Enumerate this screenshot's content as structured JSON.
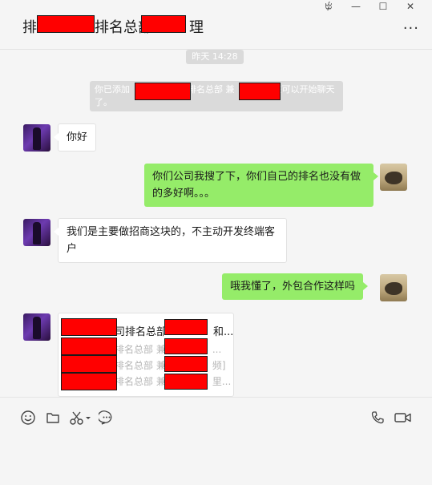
{
  "window": {
    "pin_glyph": "ꔲ",
    "minimize_glyph": "—",
    "maximize_glyph": "☐",
    "close_glyph": "✕"
  },
  "header": {
    "title_part1": "排",
    "title_part2": "排名总部",
    "title_part3": "理",
    "more_glyph": "···"
  },
  "chat": {
    "timestamp": "昨天 14:28",
    "system_notice": {
      "part1": "你已添加",
      "part2": "排名总部 兼",
      "part3": "在可以开始聊天了。"
    },
    "messages": [
      {
        "side": "in",
        "text": "你好"
      },
      {
        "side": "out",
        "text": "你们公司我搜了下，你们自己的排名也没有做的多好啊。。。"
      },
      {
        "side": "in",
        "text": "我们是主要做招商这块的，不主动开发终端客户"
      },
      {
        "side": "out",
        "text": "哦我懂了，外包合作这样吗"
      }
    ],
    "card": {
      "title_a": "司排名总部",
      "title_b": "和...",
      "lines": [
        {
          "a": "排名总部 兼",
          "b": "..."
        },
        {
          "a": "排名总部 兼",
          "b": "频]"
        },
        {
          "a": "排名总部 兼",
          "b": "里..."
        }
      ]
    }
  },
  "toolbar": {
    "icons": [
      "emoji-icon",
      "folder-icon",
      "scissors-icon",
      "chat-history-icon",
      "phone-icon",
      "video-icon"
    ]
  },
  "colors": {
    "bubble_out": "#95ec69",
    "bubble_in": "#ffffff",
    "redaction": "#ff0000",
    "background": "#f5f5f5"
  }
}
